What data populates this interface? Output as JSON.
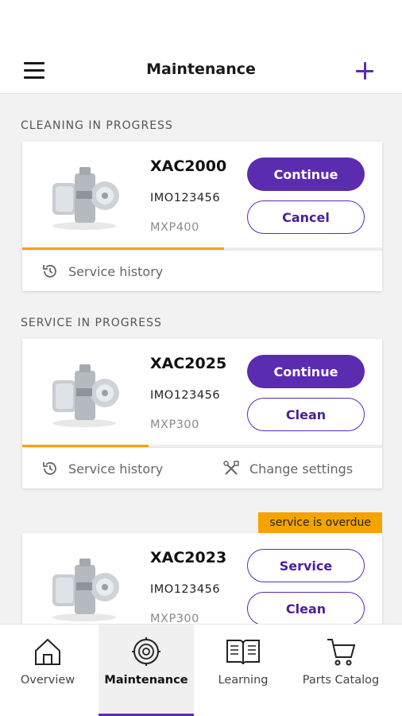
{
  "header": {
    "title": "Maintenance"
  },
  "sections": [
    {
      "label": "CLEANING IN PROGRESS",
      "card": {
        "serial": "XAC2000",
        "imo": "IMO123456",
        "model": "MXP400",
        "primary_label": "Continue",
        "secondary_label": "Cancel",
        "progress": 0.56,
        "footer": {
          "history_label": "Service history"
        }
      }
    },
    {
      "label": "SERVICE IN PROGRESS",
      "card": {
        "serial": "XAC2025",
        "imo": "IMO123456",
        "model": "MXP300",
        "primary_label": "Continue",
        "secondary_label": "Clean",
        "progress": 0.35,
        "footer": {
          "history_label": "Service history",
          "settings_label": "Change settings"
        }
      }
    },
    {
      "card": {
        "badge": "service is overdue",
        "serial": "XAC2023",
        "imo": "IMO123456",
        "model": "MXP300",
        "primary_label": "Service",
        "secondary_label": "Clean"
      }
    }
  ],
  "tabs": [
    {
      "label": "Overview",
      "icon": "home-icon"
    },
    {
      "label": "Maintenance",
      "icon": "separator-icon",
      "active": true
    },
    {
      "label": "Learning",
      "icon": "book-icon"
    },
    {
      "label": "Parts Catalog",
      "icon": "cart-icon"
    }
  ],
  "colors": {
    "accent": "#5b2bb0",
    "progress": "#f5a300",
    "badge": "#f5a300"
  }
}
